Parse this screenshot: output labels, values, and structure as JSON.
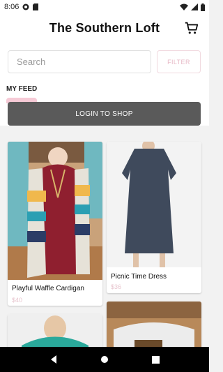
{
  "status_bar": {
    "time": "8:06",
    "icons": [
      "sync-icon",
      "sim-icon",
      "wifi-icon",
      "cell-signal-icon",
      "battery-icon"
    ]
  },
  "header": {
    "title": "The Southern Loft",
    "cart_icon": "shopping-cart-icon"
  },
  "search": {
    "placeholder": "Search",
    "filter_label": "FILTER"
  },
  "feed": {
    "label": "MY FEED",
    "login_label": "LOGIN TO SHOP"
  },
  "products": [
    {
      "name": "Playful Waffle Cardigan",
      "price": "$40"
    },
    {
      "name": "Picnic Time Dress",
      "price": "$36"
    }
  ],
  "colors": {
    "accent_pink": "#f6cad6",
    "login_button": "#5a5a5a",
    "price_pink": "#e8c6cf"
  },
  "nav_bar": {
    "icons": [
      "back-icon",
      "home-icon",
      "recents-icon"
    ]
  }
}
